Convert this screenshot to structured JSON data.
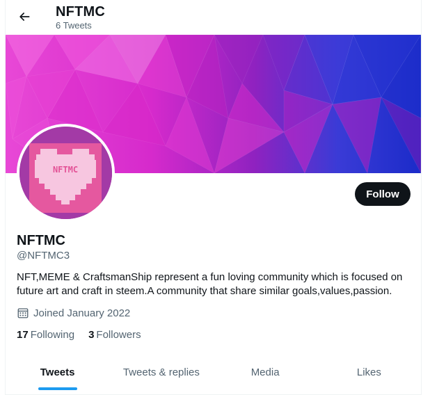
{
  "header": {
    "back_icon": "arrow-left-icon",
    "title": "NFTMC",
    "subtitle": "6 Tweets"
  },
  "banner": {
    "colors": [
      "#e63ad0",
      "#c229c8",
      "#7a22c4",
      "#3440d8",
      "#1a2ad0",
      "#f05ae0",
      "#a41fbf"
    ]
  },
  "avatar": {
    "text": "NFTMC",
    "colors": {
      "background": "#a33aa6",
      "heart": "#f7c6e0",
      "tile": "#e5589f",
      "text": "#e35296"
    }
  },
  "follow_button": {
    "label": "Follow"
  },
  "profile": {
    "name": "NFTMC",
    "handle": "@NFTMC3",
    "bio": "NFT,MEME & CraftsmanShip represent a fun loving community which is focused on future art and craft in steem.A community that share similar goals,values,passion.",
    "joined": "Joined January 2022",
    "joined_icon": "calendar-icon",
    "following_count": "17",
    "following_label": "Following",
    "followers_count": "3",
    "followers_label": "Followers"
  },
  "tabs": [
    {
      "label": "Tweets",
      "active": true
    },
    {
      "label": "Tweets & replies",
      "active": false
    },
    {
      "label": "Media",
      "active": false
    },
    {
      "label": "Likes",
      "active": false
    }
  ],
  "accent_color": "#1d9bf0"
}
